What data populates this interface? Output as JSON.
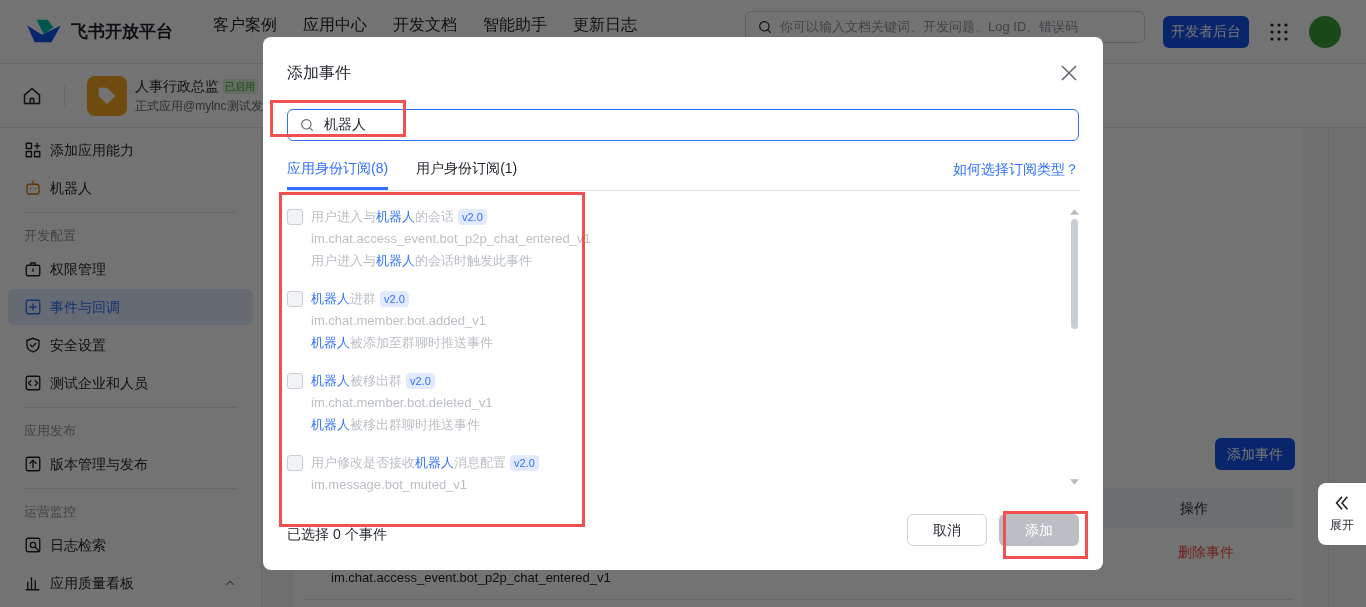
{
  "header": {
    "logo_text": "飞书开放平台",
    "nav": [
      "客户案例",
      "应用中心",
      "开发文档",
      "智能助手",
      "更新日志"
    ],
    "search": {
      "placeholder": "你可以输入文档关键词、开发问题、Log ID、错误码"
    },
    "console_button": "开发者后台"
  },
  "app_bar": {
    "name": "人事行政总监",
    "status": "已启用",
    "subtitle": "正式应用@mylnc测试发"
  },
  "sidebar": {
    "sections": [
      {
        "items": [
          {
            "label": "添加应用能力",
            "selected": false
          },
          {
            "label": "机器人",
            "selected": false
          }
        ]
      },
      {
        "title": "开发配置",
        "items": [
          {
            "label": "权限管理",
            "selected": false
          },
          {
            "label": "事件与回调",
            "selected": true
          },
          {
            "label": "安全设置",
            "selected": false
          },
          {
            "label": "测试企业和人员",
            "selected": false
          }
        ]
      },
      {
        "title": "应用发布",
        "items": [
          {
            "label": "版本管理与发布",
            "selected": false
          }
        ]
      },
      {
        "title": "运营监控",
        "items": [
          {
            "label": "日志检索",
            "selected": false
          },
          {
            "label": "应用质量看板",
            "selected": false,
            "expanded": true
          }
        ]
      }
    ]
  },
  "events_panel": {
    "add_button": "添加事件",
    "columns": [
      {
        "label": "操作"
      }
    ],
    "rows": [
      {
        "event": "im.chat.access_event.bot_p2p_chat_entered_v1",
        "action": "删除事件"
      }
    ]
  },
  "expand_button": "展开",
  "dialog": {
    "title": "添加事件",
    "search": {
      "value": "机器人"
    },
    "tabs": [
      {
        "label": "应用身份订阅(8)",
        "selected": true
      },
      {
        "label": "用户身份订阅(1)",
        "selected": false
      }
    ],
    "help_link": "如何选择订阅类型？",
    "events": [
      {
        "title": "用户进入与**机器人**的会话",
        "version": "v2.0",
        "key": "im.chat.access_event.bot_p2p_chat_entered_v1",
        "description": "用户进入与**机器人**的会话时触发此事件",
        "checked": false,
        "disabled": true
      },
      {
        "title": "**机器人**进群",
        "version": "v2.0",
        "key": "im.chat.member.bot.added_v1",
        "description": "**机器人**被添加至群聊时推送事件",
        "checked": false,
        "disabled": true
      },
      {
        "title": "**机器人**被移出群",
        "version": "v2.0",
        "key": "im.chat.member.bot.deleted_v1",
        "description": "**机器人**被移出群聊时推送事件",
        "checked": false,
        "disabled": true
      },
      {
        "title": "用户修改是否接收**机器人**消息配置",
        "version": "v2.0",
        "key": "im.message.bot_muted_v1",
        "checked": false,
        "disabled": true
      }
    ],
    "selected_count": "已选择 0 个事件",
    "cancel_button": "取消",
    "confirm_button": {
      "label": "添加",
      "disabled": true
    }
  }
}
